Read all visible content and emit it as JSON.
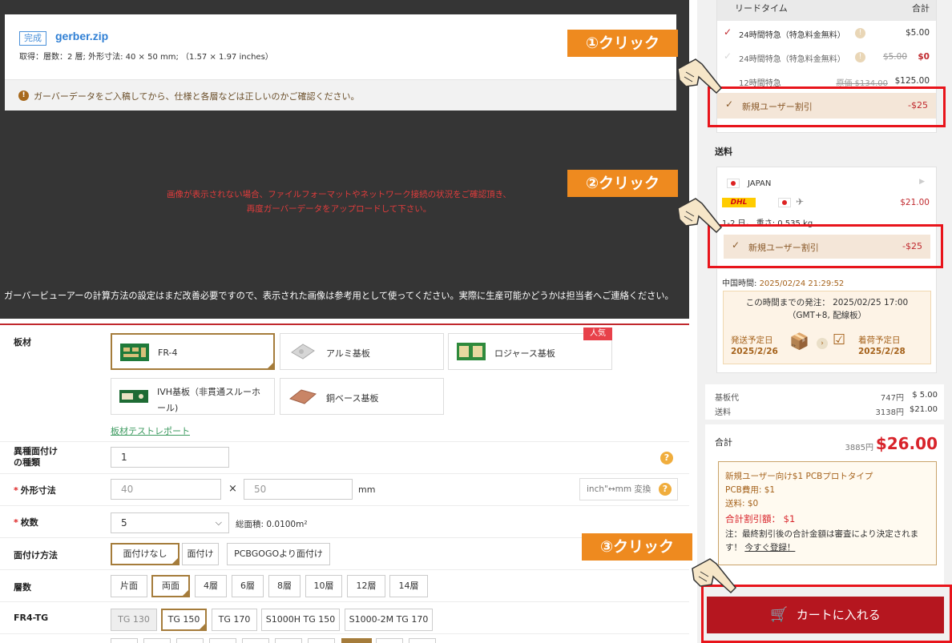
{
  "viewer": {
    "status_badge": "完成",
    "file_name": "gerber.zip",
    "file_info": "取得：層数：2 層; 外形寸法: 40 × 50 mm; （1.57 × 1.97 inches）",
    "warning": "ガーバーデータをご入稿してから、仕様と各層などは正しいのかご確認ください。",
    "error_line1": "画像が表示されない場合、ファイルフォーマットやネットワーク接続の状況をご確認頂き、",
    "error_line2": "再度ガーバーデータをアップロードして下さい。",
    "note": "ガーバービューアーの計算方法の設定はまだ改善必要ですので、表示された画像は参考用として使ってください。実際に生産可能かどうかは担当者へご連絡ください。"
  },
  "form": {
    "material": {
      "label": "板材",
      "options": [
        "FR-4",
        "アルミ基板",
        "ロジャース基板",
        "IVH基板（非貫通スルーホ",
        "ール)",
        "銅ベース基板"
      ],
      "popular_badge": "人気",
      "report_link": "板材テストレポート"
    },
    "mixed": {
      "label_line1": "異種面付け",
      "label_line2": "の種類",
      "value": "1"
    },
    "size": {
      "label": "外形寸法",
      "width": "40",
      "height": "50",
      "times": "×",
      "unit": "mm",
      "convert": "inch\"↔mm 変換"
    },
    "qty": {
      "label": "枚数",
      "value": "5",
      "area": "総面積: 0.0100m²"
    },
    "panel": {
      "label": "面付け方法",
      "options": [
        "面付けなし",
        "面付け",
        "PCBGOGOより面付け"
      ]
    },
    "layers": {
      "label": "層数",
      "options": [
        "片面",
        "両面",
        "4層",
        "6層",
        "8層",
        "10層",
        "12層",
        "14層"
      ]
    },
    "tg": {
      "label": "FR4-TG",
      "options": [
        "TG 130",
        "TG 150",
        "TG 170",
        "S1000H TG 150",
        "S1000-2M TG 170"
      ]
    },
    "required_mark": "*",
    "help": "?"
  },
  "sidebar": {
    "lead_time": {
      "header_label": "リードタイム",
      "header_total": "合計",
      "items": [
        {
          "label": "24時間特急（特急料金無料）",
          "price": "$5.00"
        },
        {
          "label": "24時間特急（特急料金無料）",
          "old_price": "$5.00",
          "price": "$0"
        },
        {
          "label": "12時間特急",
          "old_price": "原価 $134.00",
          "price": "$125.00"
        }
      ],
      "discount_label": "新規ユーザー割引",
      "discount_value": "-$25"
    },
    "shipping": {
      "title": "送料",
      "country": "JAPAN",
      "carrier": "DHL",
      "price": "$21.00",
      "meta": "1-2 日， 重さ: 0.535 kg",
      "discount_label": "新規ユーザー割引",
      "discount_value": "-$25"
    },
    "time": {
      "china_time_label": "中国時間: ",
      "china_time": "2025/02/24 21:29:52",
      "deadline_line1": "この時間までの発注： 2025/02/25 17:00",
      "deadline_line2": "（GMT+8, 配線板）",
      "ship_label": "発送予定日",
      "ship_date": "2025/2/26",
      "arrive_label": "着荷予定日",
      "arrive_date": "2025/2/28"
    },
    "costs": {
      "board_label": "基板代",
      "board_jpy": "747円",
      "board_usd": "$ 5.00",
      "ship_label": "送料",
      "ship_jpy": "3138円",
      "ship_usd": "$21.00"
    },
    "total": {
      "label": "合計",
      "jpy": "3885円",
      "usd": "$26.00"
    },
    "promo": {
      "title": "新規ユーザー向け$1 PCBプロトタイプ",
      "pcb_fee": "PCB費用: $1",
      "ship_fee": "送料: $0",
      "total_discount": "合計割引額： $1",
      "note": "注：最終割引後の合計金額は審査により決定されます！",
      "register_link": "今すぐ登録！"
    },
    "cart_button": "カートに入れる"
  },
  "annotations": {
    "step1": "①クリック",
    "step2": "②クリック",
    "step3": "③クリック"
  },
  "colors": {
    "accent": "#c0282d",
    "brand_gold": "#a57c3b",
    "callout": "#ee8a1f",
    "highlight": "#e8141b"
  }
}
